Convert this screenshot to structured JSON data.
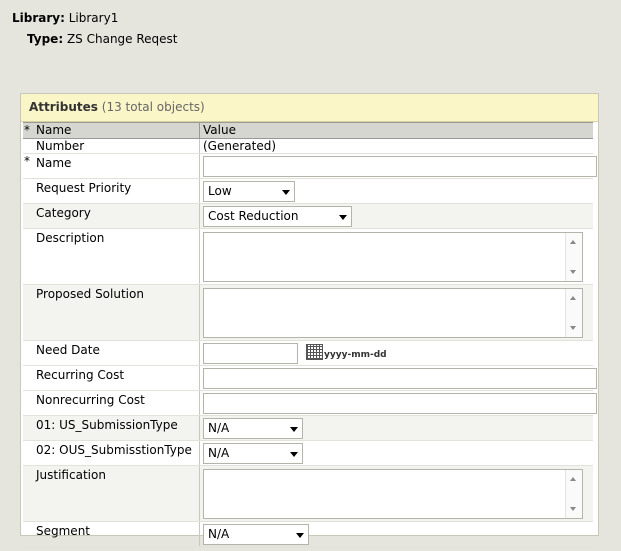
{
  "header": {
    "library_label": "Library:",
    "library_value": "Library1",
    "type_label": "Type:",
    "type_value": "ZS Change Reqest"
  },
  "panel": {
    "title": "Attributes",
    "count": "(13 total objects)",
    "col_required": "*",
    "col_name": "Name",
    "col_value": "Value"
  },
  "fields": {
    "number": {
      "label": "Number",
      "value": "(Generated)"
    },
    "name": {
      "required": "*",
      "label": "Name",
      "value": ""
    },
    "request_priority": {
      "label": "Request Priority",
      "value": "Low"
    },
    "category": {
      "label": "Category",
      "value": "Cost Reduction"
    },
    "description": {
      "label": "Description",
      "value": ""
    },
    "proposed_solution": {
      "label": "Proposed Solution",
      "value": ""
    },
    "need_date": {
      "label": "Need Date",
      "value": "",
      "format_hint": "yyyy-mm-dd"
    },
    "recurring_cost": {
      "label": "Recurring Cost",
      "value": ""
    },
    "nonrecurring_cost": {
      "label": "Nonrecurring Cost",
      "value": ""
    },
    "us_submission_type": {
      "label": "01: US_SubmissionType",
      "value": "N/A"
    },
    "ous_submission_type": {
      "label": "02: OUS_SubmisstionType",
      "value": "N/A"
    },
    "justification": {
      "label": "Justification",
      "value": ""
    },
    "segment": {
      "label": "Segment",
      "value": "N/A"
    }
  },
  "colors": {
    "background": "#e5e5dd",
    "panel_header": "#fbf6c8",
    "table_header": "#d6d6d0",
    "alt_row": "#f3f3ef"
  }
}
